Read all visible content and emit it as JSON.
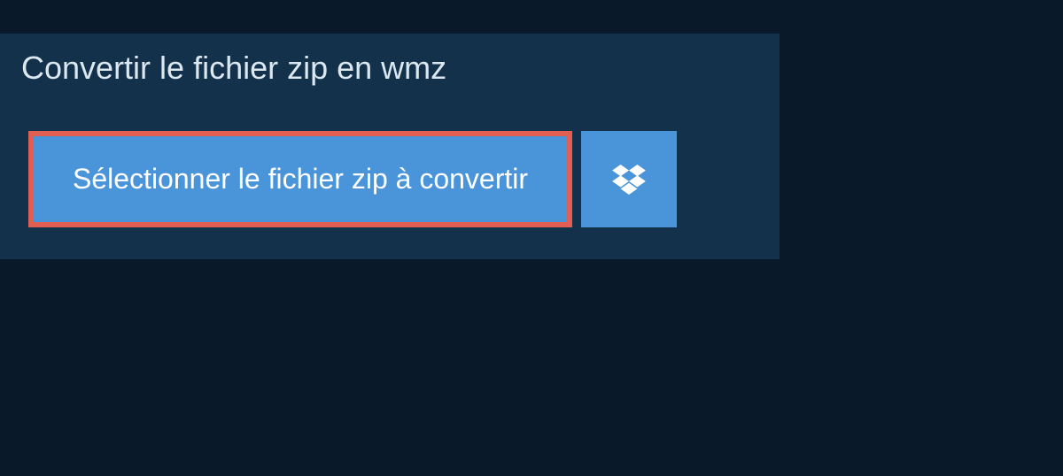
{
  "header": {
    "title": "Convertir le fichier zip en wmz"
  },
  "actions": {
    "selectFileLabel": "Sélectionner le fichier zip à convertir"
  },
  "colors": {
    "background": "#0a1929",
    "panel": "#14314b",
    "buttonBg": "#4a94d9",
    "highlightBorder": "#e15e52",
    "text": "#ffffff"
  }
}
